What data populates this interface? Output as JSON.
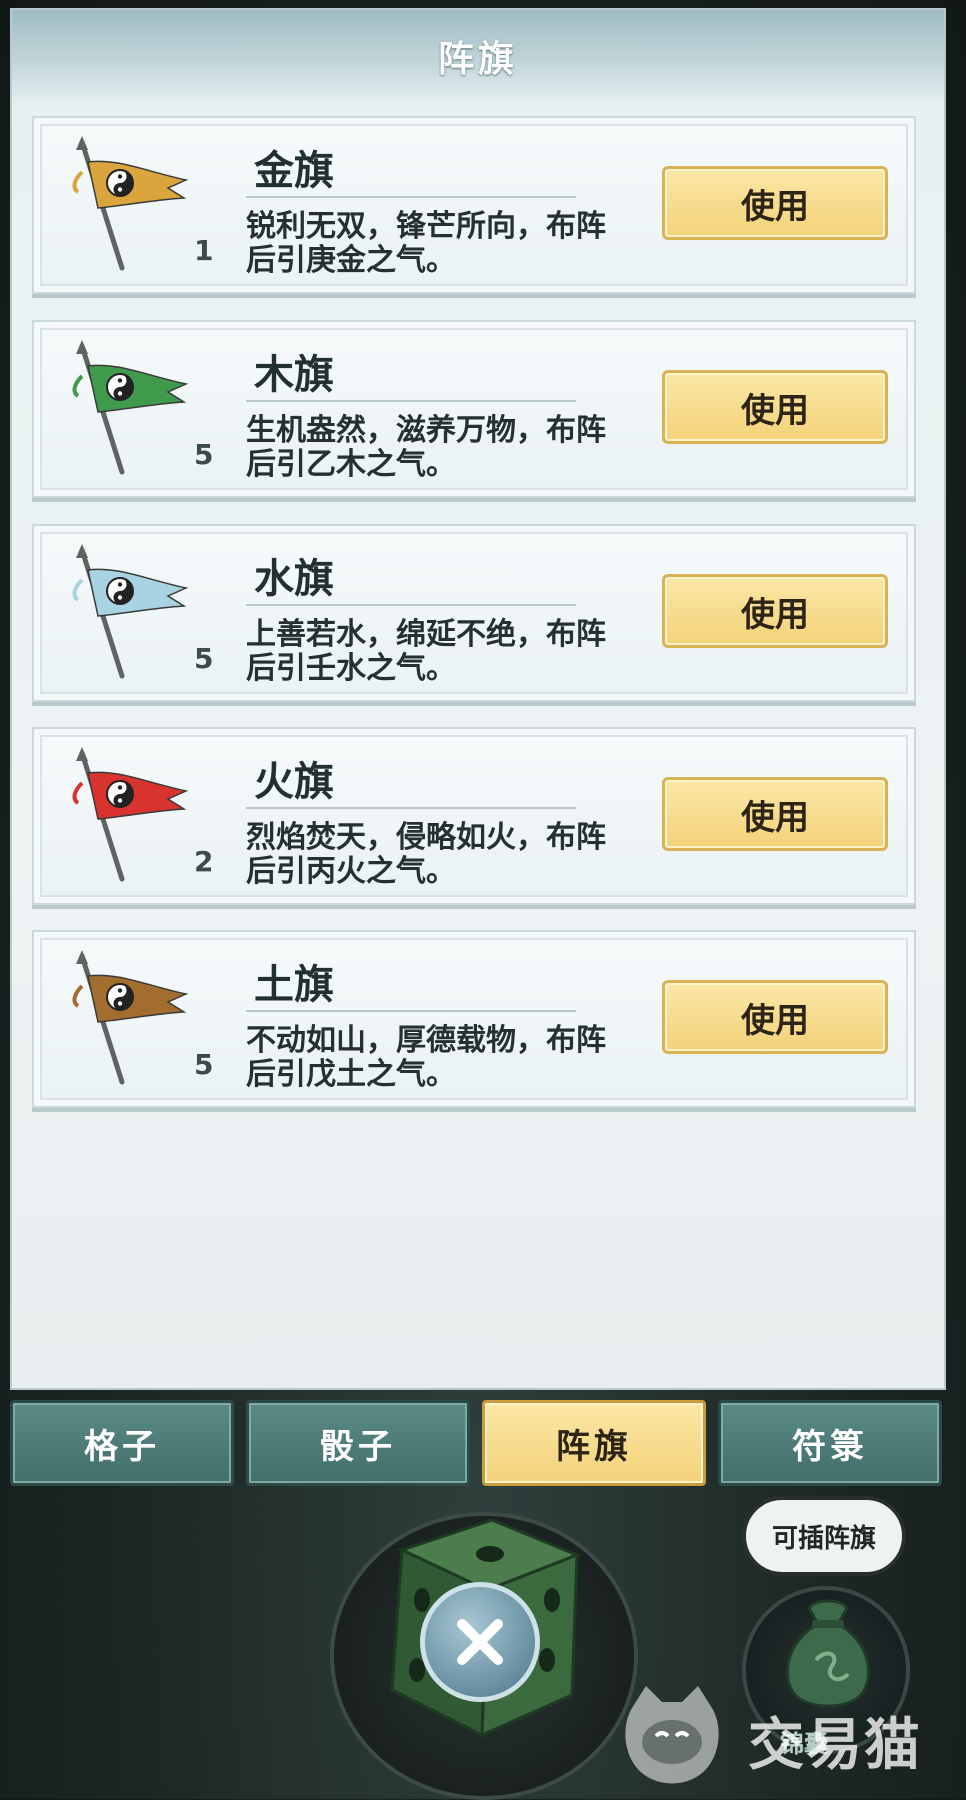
{
  "panel": {
    "title": "阵旗"
  },
  "flags": [
    {
      "name": "金旗",
      "count": "1",
      "description": "锐利无双，锋芒所向，布阵后引庚金之气。",
      "button_label": "使用",
      "color": "#d9a53c"
    },
    {
      "name": "木旗",
      "count": "5",
      "description": "生机盎然，滋养万物，布阵后引乙木之气。",
      "button_label": "使用",
      "color": "#3f9b4b"
    },
    {
      "name": "水旗",
      "count": "5",
      "description": "上善若水，绵延不绝，布阵后引壬水之气。",
      "button_label": "使用",
      "color": "#a8d3e2"
    },
    {
      "name": "火旗",
      "count": "2",
      "description": "烈焰焚天，侵略如火，布阵后引丙火之气。",
      "button_label": "使用",
      "color": "#d8332f"
    },
    {
      "name": "土旗",
      "count": "5",
      "description": "不动如山，厚德载物，布阵后引戊土之气。",
      "button_label": "使用",
      "color": "#a36d2f"
    }
  ],
  "tabs": [
    {
      "label": "格子",
      "active": false
    },
    {
      "label": "骰子",
      "active": false
    },
    {
      "label": "阵旗",
      "active": true
    },
    {
      "label": "符箓",
      "active": false
    }
  ],
  "bottom": {
    "bubble_text": "可插阵旗",
    "bag_label": "锦囊"
  },
  "watermark": {
    "text": "交易猫"
  },
  "colors": {
    "accent_gold": "#f3d27a",
    "tab_teal": "#4f7d79"
  }
}
